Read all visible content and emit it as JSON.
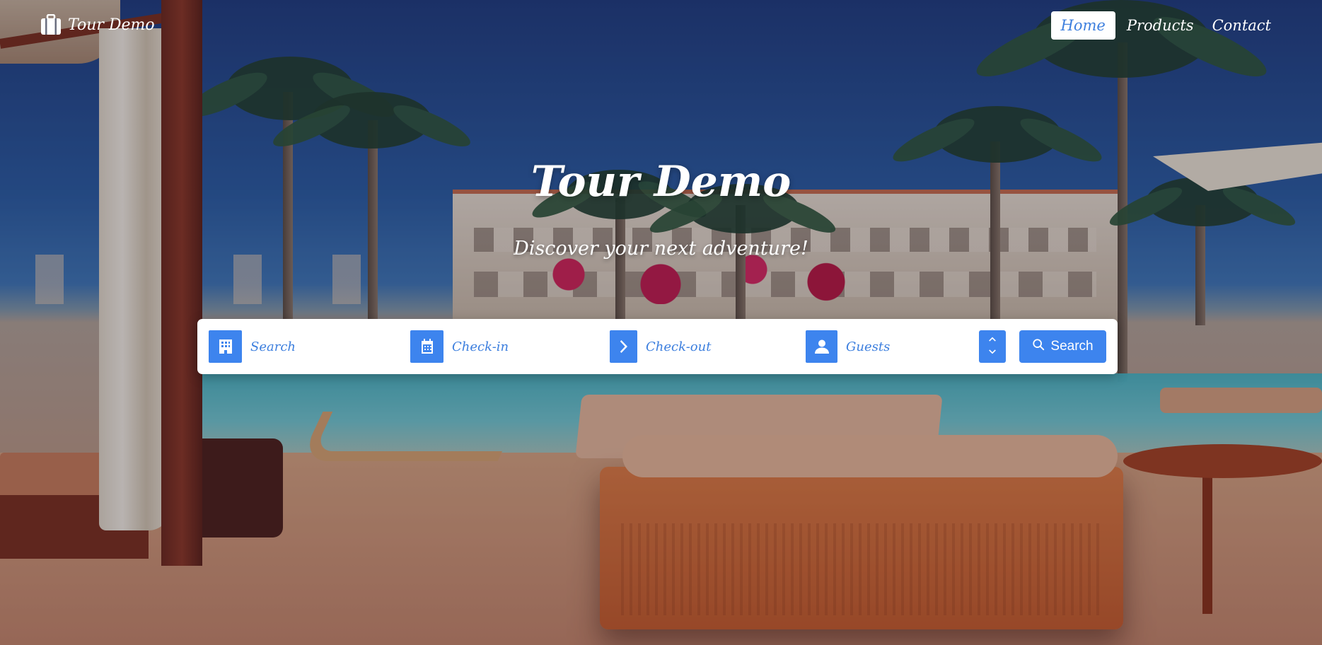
{
  "navbar": {
    "brand": {
      "icon": "suitcase-icon",
      "text": "Tour Demo"
    },
    "links": [
      {
        "label": "Home",
        "active": true
      },
      {
        "label": "Products",
        "active": false
      },
      {
        "label": "Contact",
        "active": false
      }
    ]
  },
  "hero": {
    "title": "Tour Demo",
    "subtitle": "Discover your next adventure!"
  },
  "search_bar": {
    "fields": [
      {
        "icon": "hotel-icon",
        "placeholder": "Search"
      },
      {
        "icon": "calendar-icon",
        "placeholder": "Check-in"
      },
      {
        "icon": "chevron-right-icon",
        "placeholder": "Check-out"
      },
      {
        "icon": "user-icon",
        "placeholder": "Guests"
      }
    ],
    "guest_stepper": {
      "up": "⌃",
      "down": "⌄"
    },
    "search_button": {
      "label": "Search",
      "icon": "search-icon"
    }
  },
  "colors": {
    "accent": "#3d84ee",
    "accent_text": "#3d7fde",
    "white": "#ffffff"
  }
}
